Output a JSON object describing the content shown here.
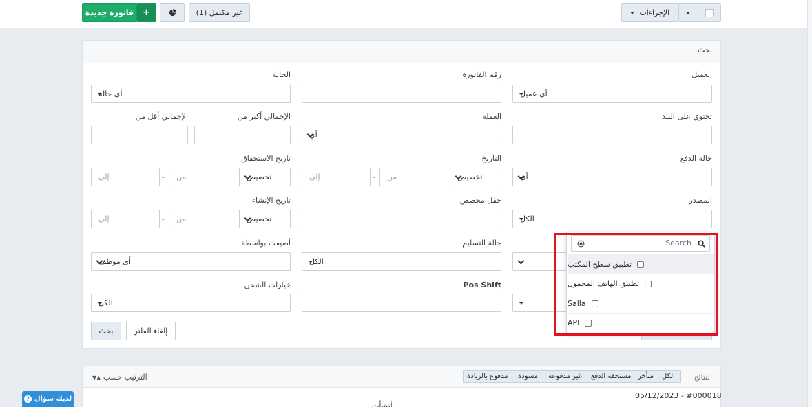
{
  "topbar": {
    "new_invoice_label": "فاتورة جديدة",
    "plus_label": "+",
    "incomplete_label": "غير مكتمل (1)",
    "actions_label": "الإجراءات"
  },
  "search_panel": {
    "title": "بحث",
    "labels": {
      "client": "العميل",
      "invoice_number": "رقم الفاتورة",
      "status": "الحالة",
      "contains_item": "تحتوي على البند",
      "currency": "العملة",
      "total_greater": "الإجمالي أكبر من",
      "total_less": "الإجمالي أقل من",
      "payment_status": "حالة الدفع",
      "date": "التاريخ",
      "due_date": "تاريخ الاستحقاق",
      "source": "المصدر",
      "custom_field": "حقل مخصص",
      "creation_date": "تاريخ الإنشاء",
      "delivery_status": "حالة التسليم",
      "added_by": "أضيفت بواسطة",
      "pos_shift": "Pos Shift",
      "shipping_options": "خيارات الشحن"
    },
    "values": {
      "client": "أي عميل",
      "status": "أي حالة",
      "currency": "أي",
      "payment_status": "أي",
      "date_mode": "تخصيص",
      "due_mode": "تخصيص",
      "creation_mode": "تخصيص",
      "source": "الكل",
      "delivery_status": "الكل",
      "added_by": "أى موظف",
      "shipping_options": "الكل"
    },
    "placeholders": {
      "from": "من",
      "to": "إلى"
    },
    "dash": "-",
    "search_button": "بحث",
    "clear_button": "إلغاء الفلتر"
  },
  "source_dropdown": {
    "search_placeholder": "Search",
    "options": [
      "تطبيق سطح المكتب",
      "تطبيق الهاتف المحمول",
      "Salla",
      "API"
    ]
  },
  "results": {
    "label": "النتائج",
    "tabs": [
      "الكل",
      "متأخر",
      "مستحقة الدفع",
      "غير مدفوعة",
      "مسودة",
      "مدفوع بالزيادة"
    ],
    "sort_label": "الترتيب حسب",
    "first_row": "05/12/2023 - #000018",
    "partial_text": "أنشأت"
  },
  "help_button": "لديك سؤال",
  "colors": {
    "green": "#1fae6a",
    "highlight_red": "#e0141e",
    "help_blue": "#2f8fd8"
  }
}
